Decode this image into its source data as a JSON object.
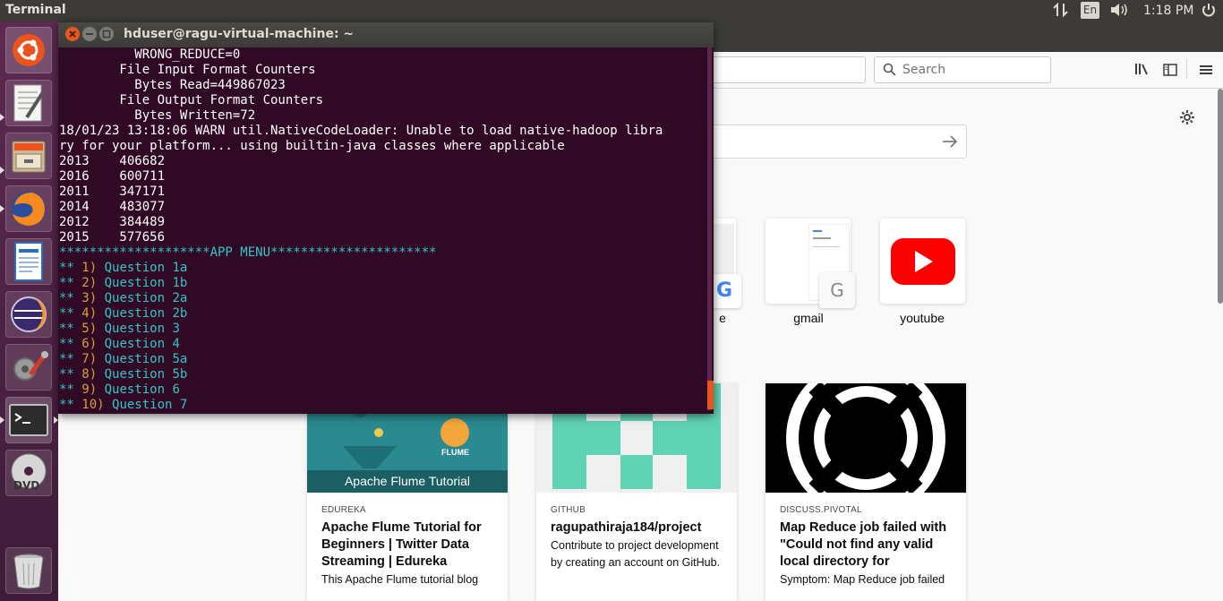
{
  "topbar": {
    "app_title": "Terminal",
    "keyboard_layout": "En",
    "clock": "1:18 PM"
  },
  "terminal": {
    "title": "hduser@ragu-virtual-machine: ~",
    "lines_plain": [
      "          WRONG_REDUCE=0",
      "        File Input Format Counters ",
      "          Bytes Read=449867023",
      "        File Output Format Counters ",
      "          Bytes Written=72",
      "18/01/23 13:18:06 WARN util.NativeCodeLoader: Unable to load native-hadoop libra",
      "ry for your platform... using builtin-java classes where applicable",
      "2013    406682",
      "2016    600711",
      "2011    347171",
      "2014    483077",
      "2012    384489",
      "2015    577656"
    ],
    "app_menu_header": "********************APP MENU**********************",
    "menu_items": [
      {
        "num": "1)",
        "label": "Question 1a"
      },
      {
        "num": "2)",
        "label": "Question 1b"
      },
      {
        "num": "3)",
        "label": "Question 2a"
      },
      {
        "num": "4)",
        "label": "Question 2b"
      },
      {
        "num": "5)",
        "label": "Question 3"
      },
      {
        "num": "6)",
        "label": "Question 4"
      },
      {
        "num": "7)",
        "label": "Question 5a"
      },
      {
        "num": "8)",
        "label": "Question 5b"
      },
      {
        "num": "9)",
        "label": "Question 6"
      },
      {
        "num": "10)",
        "label": "Question 7"
      }
    ],
    "menu_prefix": "**"
  },
  "firefox": {
    "search_placeholder": "Search",
    "top_sites": [
      {
        "label": "gmail"
      },
      {
        "label": "youtube"
      }
    ],
    "partial_label": "e",
    "cards": [
      {
        "source": "EDUREKA",
        "title": "Apache Flume Tutorial for Beginners | Twitter Data Streaming | Edureka",
        "desc": "This Apache Flume tutorial blog",
        "banner": "Apache Flume Tutorial",
        "logo_text": "FLUME"
      },
      {
        "source": "GITHUB",
        "title": "ragupathiraja184/project",
        "desc": "Contribute to project development by creating an account on GitHub."
      },
      {
        "source": "DISCUSS.PIVOTAL",
        "title": "Map Reduce job failed with \"Could not find any valid local directory for",
        "desc": "Symptom: Map Reduce job failed"
      }
    ]
  },
  "colors": {
    "terminal_bg": "#300a24",
    "cyan": "#34c5c7",
    "yellow": "#d5a03a",
    "panel": "#3c3b37"
  }
}
